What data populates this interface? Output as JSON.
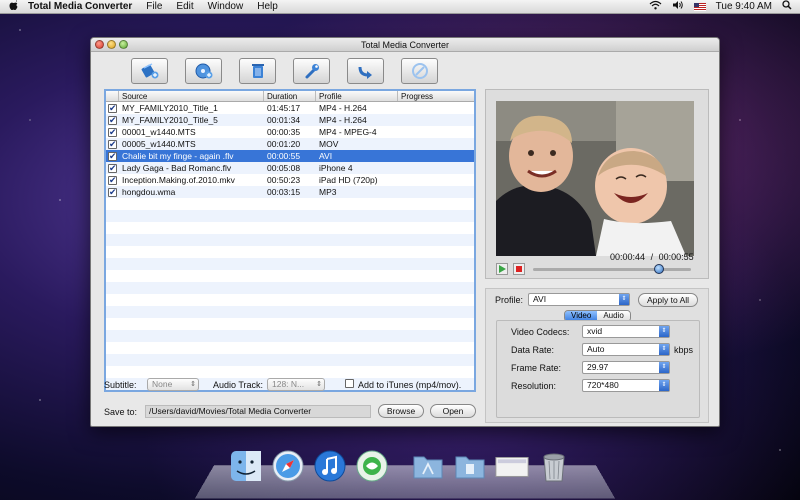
{
  "menubar": {
    "app_name": "Total Media Converter",
    "menus": [
      "File",
      "Edit",
      "Window",
      "Help"
    ],
    "clock": "Tue 9:40 AM",
    "icons": [
      "apple-icon",
      "wifi-icon",
      "volume-icon",
      "flag-icon",
      "spotlight-icon"
    ]
  },
  "window": {
    "title": "Total Media Converter"
  },
  "toolbar": {
    "buttons": [
      "add-video-button",
      "add-dvd-button",
      "delete-button",
      "settings-button",
      "convert-button",
      "stop-button"
    ]
  },
  "filelist": {
    "headers": [
      "Source",
      "Duration",
      "Profile",
      "Progress"
    ],
    "rows": [
      {
        "checked": true,
        "source": "MY_FAMILY2010_Title_1",
        "duration": "01:45:17",
        "profile": "MP4 - H.264"
      },
      {
        "checked": true,
        "source": "MY_FAMILY2010_Title_5",
        "duration": "00:01:34",
        "profile": "MP4 - H.264"
      },
      {
        "checked": true,
        "source": "00001_w1440.MTS",
        "duration": "00:00:35",
        "profile": "MP4 - MPEG-4"
      },
      {
        "checked": true,
        "source": "00005_w1440.MTS",
        "duration": "00:01:20",
        "profile": "MOV"
      },
      {
        "checked": true,
        "source": "Chalie bit my finge - again .flv",
        "duration": "00:00:55",
        "profile": "AVI",
        "selected": true
      },
      {
        "checked": true,
        "source": "Lady Gaga - Bad Romanc.flv",
        "duration": "00:05:08",
        "profile": "iPhone 4"
      },
      {
        "checked": true,
        "source": "Inception.Making.of.2010.mkv",
        "duration": "00:50:23",
        "profile": "iPad HD (720p)"
      },
      {
        "checked": true,
        "source": "hongdou.wma",
        "duration": "00:03:15",
        "profile": "MP3"
      }
    ]
  },
  "bottom": {
    "subtitle_label": "Subtitle:",
    "subtitle_value": "None",
    "audio_track_label": "Audio Track:",
    "audio_track_value": "128: N...",
    "itunes_label": "Add to iTunes (mp4/mov).",
    "save_to_label": "Save to:",
    "save_path": "/Users/david/Movies/Total Media Converter",
    "browse_label": "Browse",
    "open_label": "Open"
  },
  "preview": {
    "time_current": "00:00:44",
    "time_separator": "/",
    "time_total": "00:00:55",
    "progress": 0.8
  },
  "settings": {
    "profile_label": "Profile:",
    "profile_value": "AVI",
    "apply_all_label": "Apply to All",
    "tabs": [
      "Video",
      "Audio"
    ],
    "active_tab": "Video",
    "fields": [
      {
        "label": "Video Codecs:",
        "value": "xvid",
        "unit": ""
      },
      {
        "label": "Data Rate:",
        "value": "Auto",
        "unit": "kbps"
      },
      {
        "label": "Frame Rate:",
        "value": "29.97",
        "unit": ""
      },
      {
        "label": "Resolution:",
        "value": "720*480",
        "unit": ""
      }
    ]
  },
  "dock": {
    "icons": [
      "finder-icon",
      "safari-icon",
      "itunes-icon",
      "total-media-converter-icon",
      "applications-folder-icon",
      "documents-folder-icon",
      "screen-icon",
      "trash-icon"
    ]
  },
  "colors": {
    "selection": "#3875d7",
    "list_border": "#7aa7e0",
    "alt_row": "#edf3fd"
  }
}
